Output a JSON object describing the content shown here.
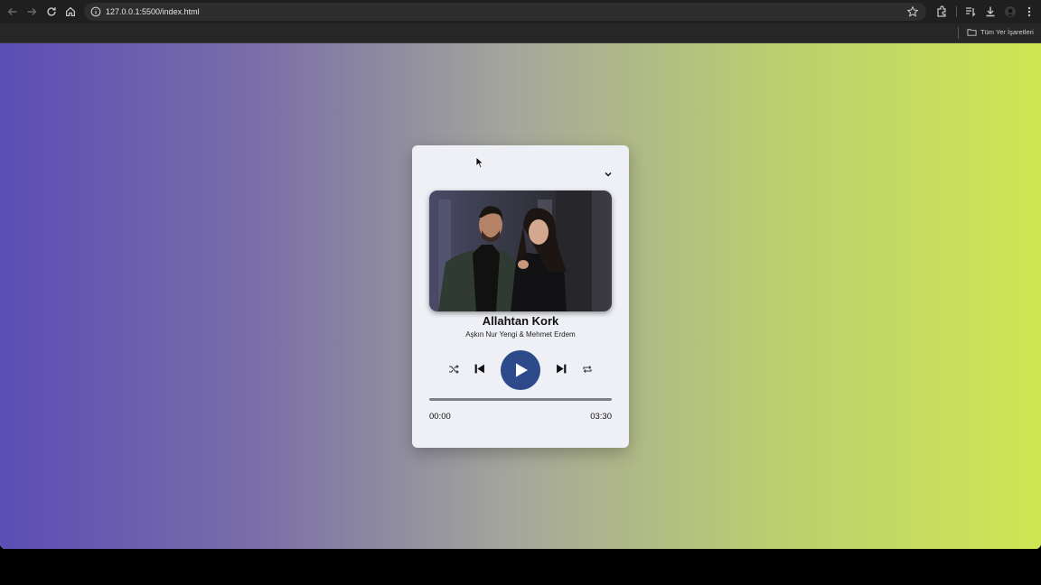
{
  "browser": {
    "url": "127.0.0.1:5500/index.html",
    "bookmarks_label": "Tüm Yer İşaretleri"
  },
  "player": {
    "song_title": "Allahtan Kork",
    "artist": "Aşkın Nur Yengi & Mehmet Erdem",
    "current_time": "00:00",
    "duration": "03:30",
    "progress": 0,
    "accent_color": "#2d4a8a"
  },
  "background_gradient": [
    "#5c4db5",
    "#cfe653"
  ]
}
